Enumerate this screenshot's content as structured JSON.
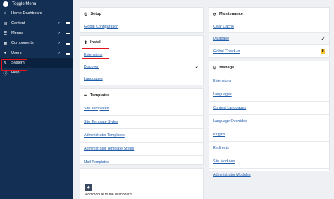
{
  "sidebar": {
    "toggle_label": "Toggle Menu",
    "items": [
      {
        "label": "Home Dashboard"
      },
      {
        "label": "Content"
      },
      {
        "label": "Menus"
      },
      {
        "label": "Components"
      },
      {
        "label": "Users"
      },
      {
        "label": "System"
      },
      {
        "label": "Help"
      }
    ]
  },
  "setup": {
    "title": "Setup",
    "links": [
      "Global Configuration"
    ]
  },
  "install": {
    "title": "Install",
    "links": [
      "Extensions",
      "Discover",
      "Languages"
    ]
  },
  "templates": {
    "title": "Templates",
    "links": [
      "Site Templates",
      "Site Template Styles",
      "Administrator Templates",
      "Administrator Template Styles",
      "Mail Templates"
    ]
  },
  "add_module": {
    "icon": "+",
    "label": "Add module to the dashboard"
  },
  "maintenance": {
    "title": "Maintenance",
    "links": [
      "Clear Cache",
      "Database",
      "Global Check-in"
    ],
    "checkin_badge": "8"
  },
  "manage": {
    "title": "Manage",
    "links": [
      "Extensions",
      "Languages",
      "Content Languages",
      "Language Overrides",
      "Plugins",
      "Redirects",
      "Site Modules",
      "Administrator Modules"
    ]
  },
  "colors": {
    "sidebar_bg": "#132f53",
    "link": "#1f5dab",
    "highlight": "#e3141b",
    "badge": "#f4c430"
  }
}
